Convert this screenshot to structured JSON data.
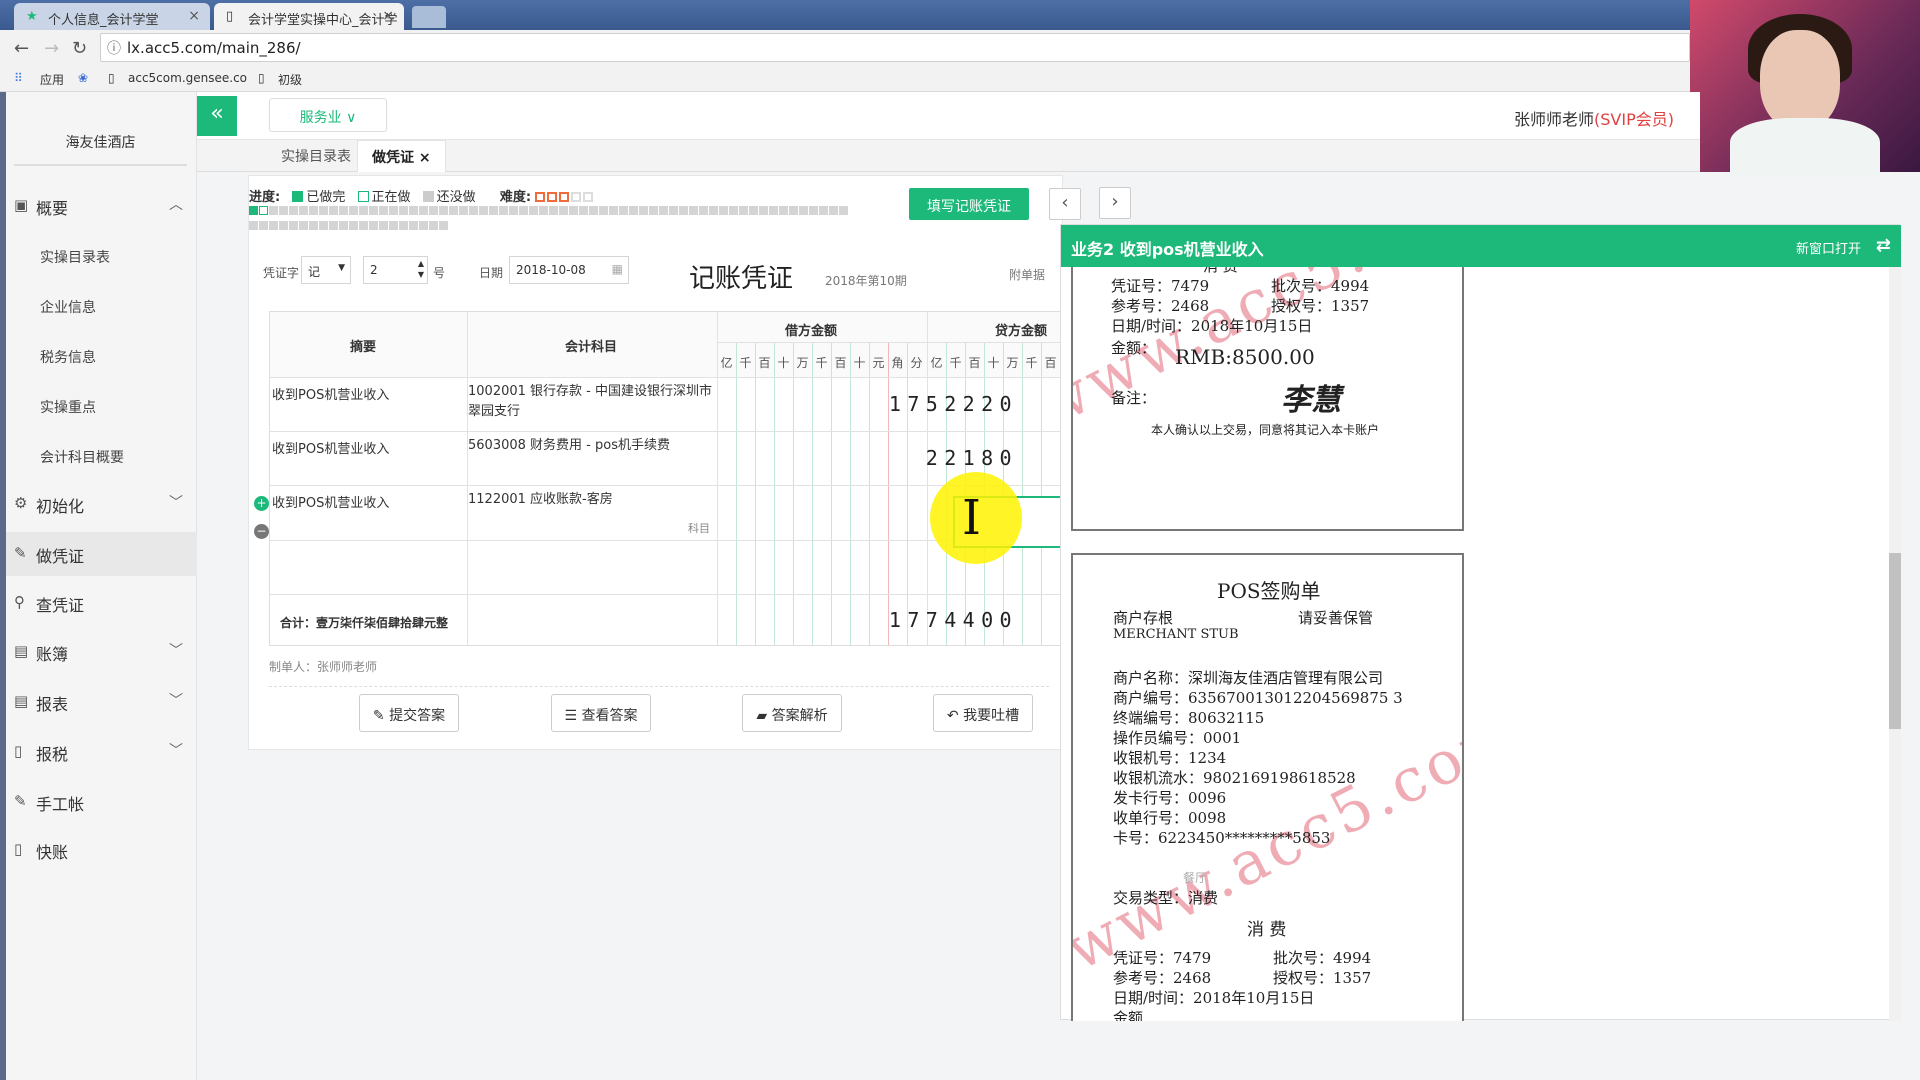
{
  "browser": {
    "tabs": [
      {
        "label": "个人信息_会计学堂"
      },
      {
        "label": "会计学堂实操中心_会计学"
      }
    ],
    "url": "lx.acc5.com/main_286/",
    "bookmarks": [
      "应用",
      "acc5com.gensee.co",
      "初级"
    ]
  },
  "sidebar": {
    "company": "海友佳酒店",
    "items": [
      {
        "label": "概要",
        "icon": "overview-icon"
      },
      {
        "label": "初始化",
        "icon": "gear-icon"
      },
      {
        "label": "做凭证",
        "icon": "pen-icon"
      },
      {
        "label": "查凭证",
        "icon": "search-icon"
      },
      {
        "label": "账簿",
        "icon": "book-icon"
      },
      {
        "label": "报表",
        "icon": "report-icon"
      },
      {
        "label": "报税",
        "icon": "file-icon"
      },
      {
        "label": "手工帐",
        "icon": "pen-icon"
      },
      {
        "label": "快账",
        "icon": "file-icon"
      }
    ],
    "subitems": [
      "实操目录表",
      "企业信息",
      "税务信息",
      "实操重点",
      "会计科目概要"
    ]
  },
  "topbar": {
    "collapse": "«",
    "service": "服务业",
    "teacher": "张师师老师",
    "vip": "(SVIP会员)"
  },
  "tabs": [
    {
      "label": "实操目录表"
    },
    {
      "label": "做凭证"
    }
  ],
  "progress": {
    "label": "进度:",
    "done": "已做完",
    "doing": "正在做",
    "todo": "还没做",
    "difficulty": "难度:",
    "stars": 3,
    "done_count": 1,
    "total_cells": 80
  },
  "fill_button": "填写记账凭证",
  "voucher": {
    "word_label": "凭证字",
    "word": "记",
    "number": "2",
    "number_suffix": "号",
    "date_label": "日期",
    "date": "2018-10-08",
    "title": "记账凭证",
    "period": "2018年第10期",
    "attach_label": "附单据",
    "headers": {
      "summary": "摘要",
      "account": "会计科目",
      "debit": "借方金额",
      "credit": "贷方金额"
    },
    "digit_units": [
      "亿",
      "千",
      "百",
      "十",
      "万",
      "千",
      "百",
      "十",
      "元",
      "角",
      "分"
    ],
    "rows": [
      {
        "summary": "收到POS机营业收入",
        "account": "1002001 银行存款 - 中国建设银行深圳市翠园支行",
        "debit": "1752220"
      },
      {
        "summary": "收到POS机营业收入",
        "account": "5603008 财务费用 - pos机手续费",
        "debit": "22180"
      },
      {
        "summary": "收到POS机营业收入",
        "account": "1122001 应收账款-客房",
        "account_hint": "科目",
        "debit": ""
      }
    ],
    "total_label": "合计：壹万柒仟柒佰肆拾肆元整",
    "total": "1774400",
    "maker": "制单人：张师师老师"
  },
  "actions": [
    "提交答案",
    "查看答案",
    "答案解析",
    "我要吐槽"
  ],
  "doc": {
    "title": "业务2 收到pos机营业收入",
    "new_window": "新窗口打开",
    "receipt1": {
      "partial_top": "消    费",
      "lines": [
        [
          "凭证号：7479",
          "批次号：4994"
        ],
        [
          "参考号：2468",
          "授权号：1357"
        ]
      ],
      "datetime": "日期/时间：2018年10月15日",
      "amount_label": "金额：",
      "amount": "RMB:8500.00",
      "remark_label": "备注：",
      "signature": "李慧",
      "confirm": "本人确认以上交易，同意将其记入本卡账户"
    },
    "receipt2": {
      "title": "POS签购单",
      "stub": "商户存根",
      "keep": "请妥善保管",
      "stub_en": "MERCHANT STUB",
      "fields": [
        "商户名称：深圳海友佳酒店管理有限公司",
        "商户编号：635670013012204569875 3",
        "终端编号：80632115",
        "操作员编号：0001",
        "收银机号：1234",
        "收银机流水：9802169198618528",
        "发卡行号：0096",
        "收单行号：0098",
        "卡号：6223450*********5853"
      ],
      "faded": "餐厅",
      "txn_type": "交易类型：消费",
      "txn_big": "消    费",
      "lines": [
        [
          "凭证号：7479",
          "批次号：4994"
        ],
        [
          "参考号：2468",
          "授权号：1357"
        ]
      ],
      "datetime": "日期/时间：2018年10月15日",
      "amount_label": "金额"
    },
    "watermark": "www.acc5.com"
  },
  "colors": {
    "accent": "#1db97a",
    "vip": "#e04040"
  }
}
